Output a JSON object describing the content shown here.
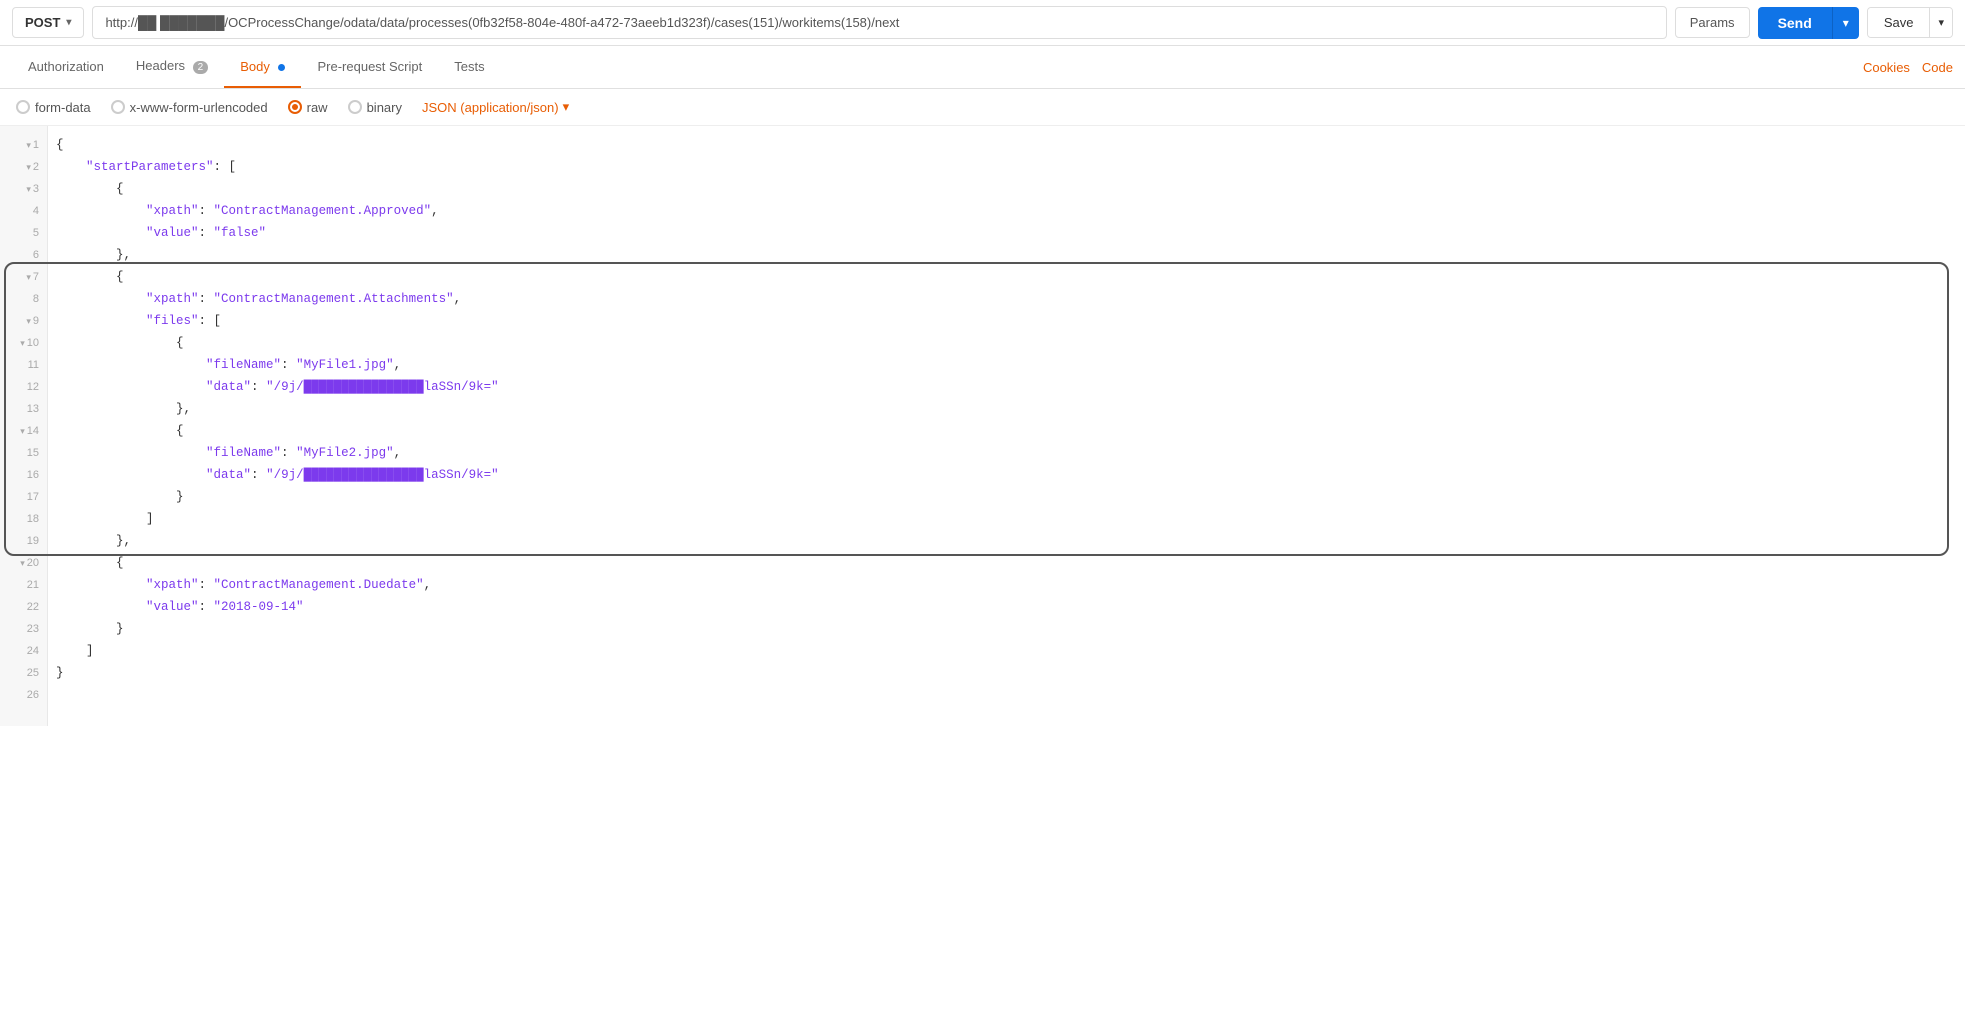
{
  "topbar": {
    "method": "POST",
    "chevron": "▾",
    "url": "http://██ ███████/OCProcessChange/odata/data/processes(0fb32f58-804e-480f-a472-73aeeb1d323f)/cases(151)/workitems(158)/next",
    "url_display": "http://██ ███████/OCProcessChange/odata/data/processes(0fb32f58-804e-480f-a472-73aeeb1d323f)/cases(151)/workitems(158)/next",
    "params_label": "Params",
    "send_label": "Send",
    "save_label": "Save"
  },
  "tabs": {
    "items": [
      {
        "id": "authorization",
        "label": "Authorization",
        "active": false,
        "badge": null,
        "dot": false
      },
      {
        "id": "headers",
        "label": "Headers",
        "active": false,
        "badge": "2",
        "dot": false
      },
      {
        "id": "body",
        "label": "Body",
        "active": true,
        "badge": null,
        "dot": true
      },
      {
        "id": "pre-request",
        "label": "Pre-request Script",
        "active": false,
        "badge": null,
        "dot": false
      },
      {
        "id": "tests",
        "label": "Tests",
        "active": false,
        "badge": null,
        "dot": false
      }
    ],
    "right": [
      {
        "id": "cookies",
        "label": "Cookies"
      },
      {
        "id": "code",
        "label": "Code"
      }
    ]
  },
  "body_options": {
    "items": [
      {
        "id": "form-data",
        "label": "form-data",
        "checked": false
      },
      {
        "id": "urlencoded",
        "label": "x-www-form-urlencoded",
        "checked": false
      },
      {
        "id": "raw",
        "label": "raw",
        "checked": true
      },
      {
        "id": "binary",
        "label": "binary",
        "checked": false
      }
    ],
    "json_type": "JSON (application/json)",
    "chevron": "▾"
  },
  "editor": {
    "lines": [
      {
        "num": 1,
        "fold": true,
        "content": "{"
      },
      {
        "num": 2,
        "fold": true,
        "content": "    \"startParameters\": ["
      },
      {
        "num": 3,
        "fold": true,
        "content": "        {"
      },
      {
        "num": 4,
        "fold": false,
        "content": "            \"xpath\": \"ContractManagement.Approved\","
      },
      {
        "num": 5,
        "fold": false,
        "content": "            \"value\": \"false\""
      },
      {
        "num": 6,
        "fold": false,
        "content": "        },"
      },
      {
        "num": 7,
        "fold": true,
        "content": "        {"
      },
      {
        "num": 8,
        "fold": false,
        "content": "            \"xpath\": \"ContractManagement.Attachments\","
      },
      {
        "num": 9,
        "fold": true,
        "content": "            \"files\": ["
      },
      {
        "num": 10,
        "fold": true,
        "content": "                {"
      },
      {
        "num": 11,
        "fold": false,
        "content": "                    \"fileName\": \"MyFile1.jpg\","
      },
      {
        "num": 12,
        "fold": false,
        "content": "                    \"data\": \"/9j/████████████████laSSn/9k=\""
      },
      {
        "num": 13,
        "fold": false,
        "content": "                },"
      },
      {
        "num": 14,
        "fold": true,
        "content": "                {"
      },
      {
        "num": 15,
        "fold": false,
        "content": "                    \"fileName\": \"MyFile2.jpg\","
      },
      {
        "num": 16,
        "fold": false,
        "content": "                    \"data\": \"/9j/████████████████laSSn/9k=\""
      },
      {
        "num": 17,
        "fold": false,
        "content": "                }"
      },
      {
        "num": 18,
        "fold": false,
        "content": "            ]"
      },
      {
        "num": 19,
        "fold": false,
        "content": "        },"
      },
      {
        "num": 20,
        "fold": true,
        "content": "        {"
      },
      {
        "num": 21,
        "fold": false,
        "content": "            \"xpath\": \"ContractManagement.Duedate\","
      },
      {
        "num": 22,
        "fold": false,
        "content": "            \"value\": \"2018-09-14\""
      },
      {
        "num": 23,
        "fold": false,
        "content": "        }"
      },
      {
        "num": 24,
        "fold": false,
        "content": "    ]"
      },
      {
        "num": 25,
        "fold": false,
        "content": "}"
      },
      {
        "num": 26,
        "fold": false,
        "content": ""
      }
    ],
    "highlight": {
      "top_line": 7,
      "bottom_line": 19
    }
  },
  "colors": {
    "accent_orange": "#e85d04",
    "send_blue": "#1074e7",
    "key_purple": "#7c3aed"
  }
}
